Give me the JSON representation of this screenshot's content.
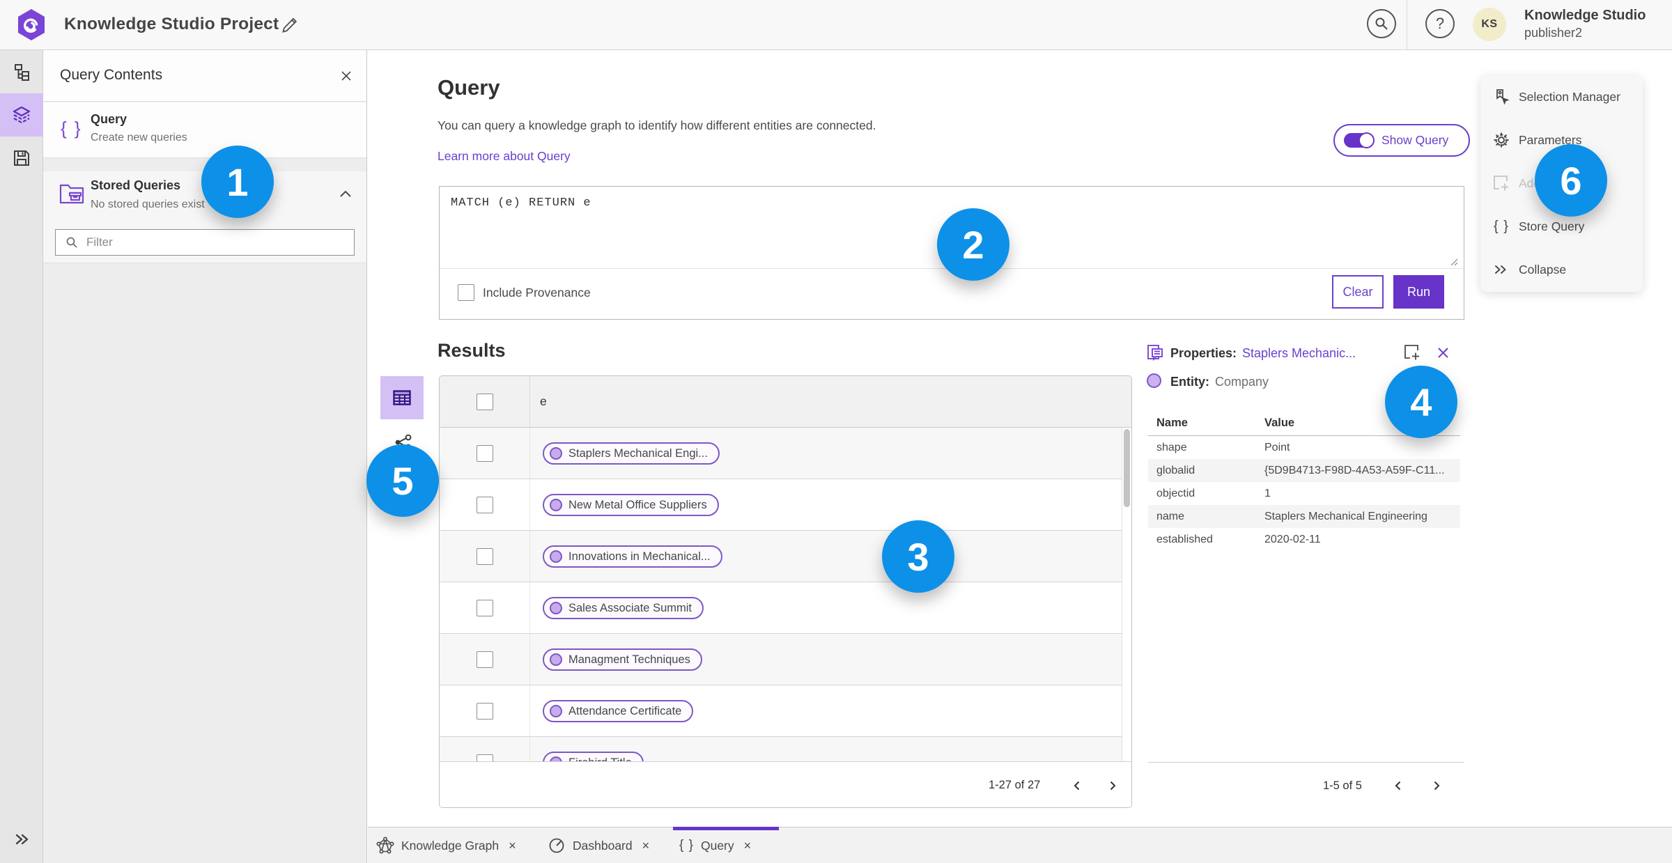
{
  "header": {
    "title": "Knowledge Studio Project",
    "user_name": "Knowledge Studio",
    "user_role": "publisher2",
    "avatar_initials": "KS",
    "help_glyph": "?"
  },
  "left_panel": {
    "title": "Query Contents",
    "close_glyph": "×",
    "query_item": {
      "title": "Query",
      "subtitle": "Create new queries",
      "icon_glyph": "{ }"
    },
    "stored_item": {
      "title": "Stored Queries",
      "subtitle": "No stored queries exist"
    },
    "filter_placeholder": "Filter"
  },
  "query_section": {
    "heading": "Query",
    "description": "You can query a knowledge graph to identify how different entities are connected.",
    "learn_more": "Learn more about Query",
    "show_query_label": "Show Query",
    "query_text": "MATCH (e) RETURN e",
    "include_provenance": "Include Provenance",
    "clear_label": "Clear",
    "run_label": "Run"
  },
  "results": {
    "heading": "Results",
    "column": "e",
    "rows": [
      {
        "label": "Staplers Mechanical Engi..."
      },
      {
        "label": "New Metal Office Suppliers"
      },
      {
        "label": "Innovations in Mechanical..."
      },
      {
        "label": "Sales Associate Summit"
      },
      {
        "label": "Managment Techniques"
      },
      {
        "label": "Attendance Certificate"
      },
      {
        "label": "Firebird Title"
      }
    ],
    "pagination": "1-27 of 27"
  },
  "properties": {
    "title": "Properties:",
    "selected_entity": "Staplers Mechanic...",
    "entity_label": "Entity:",
    "entity_type": "Company",
    "name_column": "Name",
    "value_column": "Value",
    "rows": [
      {
        "name": "shape",
        "value": "Point"
      },
      {
        "name": "globalid",
        "value": "{5D9B4713-F98D-4A53-A59F-C11..."
      },
      {
        "name": "objectid",
        "value": "1"
      },
      {
        "name": "name",
        "value": "Staplers Mechanical Engineering"
      },
      {
        "name": "established",
        "value": "2020-02-11"
      }
    ],
    "pagination": "1-5 of 5"
  },
  "right_panel": {
    "items": [
      {
        "label": "Selection Manager"
      },
      {
        "label": "Parameters"
      },
      {
        "label": "Add"
      },
      {
        "label": "Store Query",
        "icon_glyph": "{ }"
      },
      {
        "label": "Collapse"
      }
    ]
  },
  "tabs": [
    {
      "label": "Knowledge Graph",
      "close_glyph": "×"
    },
    {
      "label": "Dashboard",
      "close_glyph": "×"
    },
    {
      "label": "Query",
      "close_glyph": "×",
      "icon_glyph": "{ }"
    }
  ],
  "callouts": [
    {
      "number": "1"
    },
    {
      "number": "2"
    },
    {
      "number": "3"
    },
    {
      "number": "4"
    },
    {
      "number": "5"
    },
    {
      "number": "6"
    }
  ],
  "colors": {
    "accent_purple": "#6733c9",
    "light_purple": "#d5c0f5",
    "callout_blue": "#0d90e8",
    "link_purple": "#6b3fd0"
  }
}
